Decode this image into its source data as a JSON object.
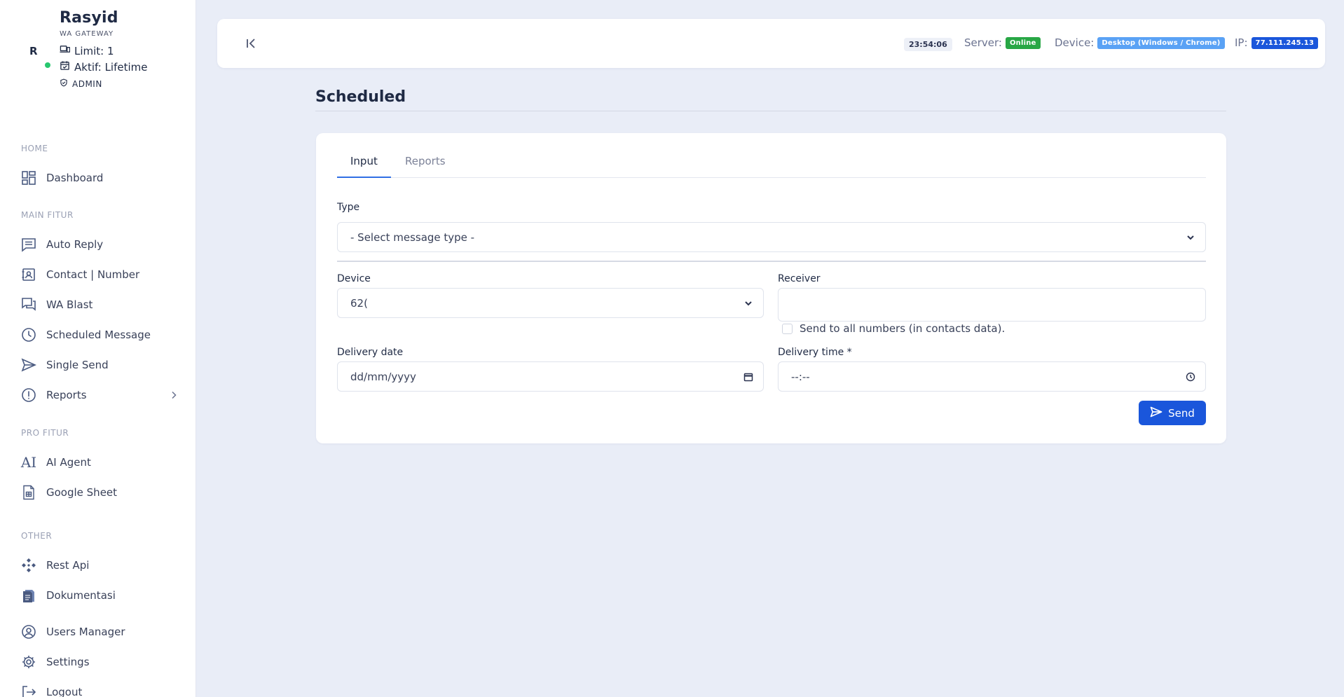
{
  "profile": {
    "avatar": "R",
    "name": "Rasyid",
    "subtitle": "WA GATEWAY",
    "limit": "Limit: 1",
    "aktif": "Aktif: Lifetime",
    "role": "ADMIN"
  },
  "sidebar": {
    "sections": {
      "home": "HOME",
      "main": "MAIN FITUR",
      "pro": "PRO FITUR",
      "other": "OTHER"
    },
    "items": {
      "dashboard": "Dashboard",
      "auto_reply": "Auto Reply",
      "contact": "Contact | Number",
      "wa_blast": "WA Blast",
      "scheduled": "Scheduled Message",
      "single_send": "Single Send",
      "reports": "Reports",
      "ai_agent": "AI Agent",
      "google_sheet": "Google Sheet",
      "rest_api": "Rest Api",
      "dokumentasi": "Dokumentasi",
      "users_manager": "Users Manager",
      "settings": "Settings",
      "logout": "Logout"
    },
    "ai_icon_text": "AI"
  },
  "topbar": {
    "time": "23:54:06",
    "server_label": "Server:",
    "server_status": "Online",
    "device_label": "Device:",
    "device_value": "Desktop (Windows / Chrome)",
    "ip_label": "IP:",
    "ip_value": "77.111.245.13"
  },
  "page": {
    "title": "Scheduled"
  },
  "form": {
    "tabs": [
      "Input",
      "Reports"
    ],
    "type_label": "Type",
    "type_value": "- Select message type -",
    "device_label": "Device",
    "device_value": "62(",
    "receiver_label": "Receiver",
    "receiver_value": "",
    "send_all_label": "Send to all numbers (in contacts data).",
    "delivery_date_label": "Delivery date",
    "delivery_date_placeholder": "dd/mm/yyyy",
    "delivery_time_label": "Delivery time *",
    "delivery_time_placeholder": "--:--",
    "send_label": "Send"
  },
  "colors": {
    "accent": "#1a56db",
    "online": "#28a745",
    "device_badge": "#5aa2f5",
    "status_dot": "#28c76f",
    "background": "#e9edf7"
  }
}
